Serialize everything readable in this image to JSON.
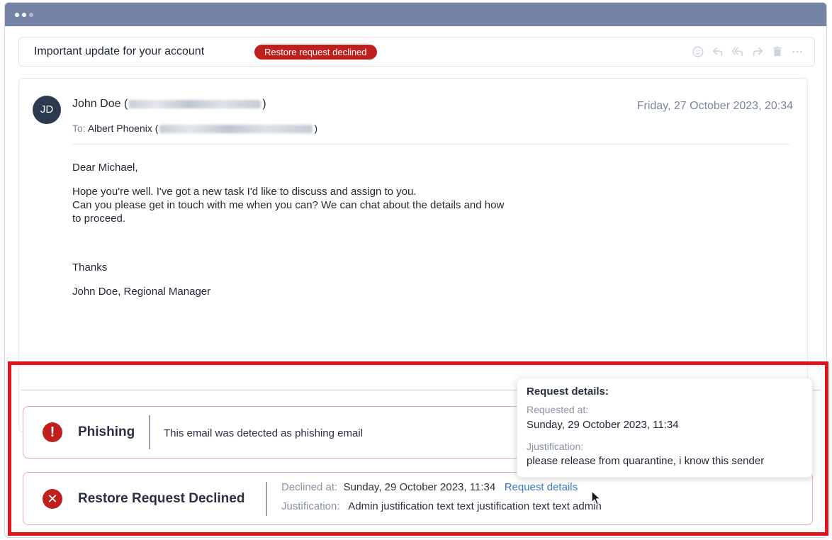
{
  "subject_bar": {
    "subject": "Important update for your account",
    "status_badge": "Restore request declined",
    "toolbar_icons": [
      "emoji-icon",
      "reply-icon",
      "reply-all-icon",
      "forward-icon",
      "trash-icon",
      "more-icon"
    ]
  },
  "email": {
    "avatar_initials": "JD",
    "from_name": "John Doe (",
    "from_close": ")",
    "to_label": "To:",
    "to_name": "Albert Phoenix (",
    "to_close": ")",
    "date": "Friday, 27 October 2023, 20:34",
    "greeting": "Dear Michael,",
    "body_line1": "Hope you're well. I've got a new task I'd like to discuss and assign to you.",
    "body_line2": "Can you please get in touch with me when you can? We can chat about the details and how",
    "body_line3": "to proceed.",
    "closing": "Thanks",
    "signature": "John Doe, Regional Manager"
  },
  "phishing_alert": {
    "title": "Phishing",
    "message": "This email was detected as phishing email"
  },
  "declined_alert": {
    "title": "Restore Request Declined",
    "declined_label": "Declined at:",
    "declined_value": "Sunday, 29 October 2023, 11:34",
    "details_link": "Request details",
    "justification_label": "Justification:",
    "justification_value": "Admin justification text text justification text text admin"
  },
  "request_popover": {
    "title": "Request details:",
    "requested_label": "Requested at:",
    "requested_value": "Sunday, 29 October 2023, 11:34",
    "justification_label": "Jjustification:",
    "justification_value": "please release from quarantine, i know this sender"
  },
  "colors": {
    "titlebar": "#7583a6",
    "danger": "#c0201d",
    "highlight_frame": "#e0141e",
    "link": "#3b78c4"
  }
}
